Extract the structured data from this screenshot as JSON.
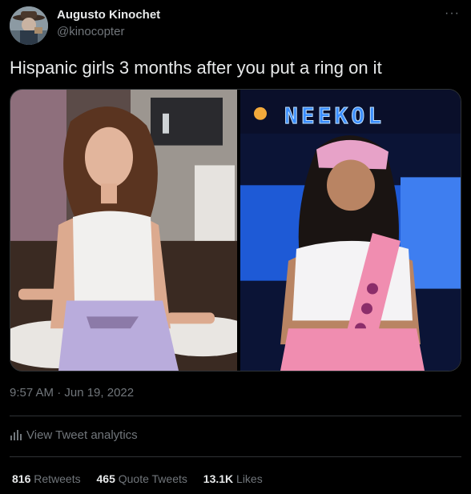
{
  "author": {
    "display_name": "Augusto Kinochet",
    "handle": "@kinocopter"
  },
  "menu_icon": "more-horizontal-icon",
  "tweet": {
    "text": "Hispanic girls 3 months after you put a ring on it"
  },
  "media": {
    "right_sign_text": "NEEKOL"
  },
  "timestamp": "9:57 AM · Jun 19, 2022",
  "analytics": {
    "icon": "bar-chart-icon",
    "label": "View Tweet analytics"
  },
  "stats": {
    "retweets": {
      "count": "816",
      "label": "Retweets"
    },
    "quote_tweets": {
      "count": "465",
      "label": "Quote Tweets"
    },
    "likes": {
      "count": "13.1K",
      "label": "Likes"
    }
  },
  "colors": {
    "background": "#000000",
    "primary_text": "#e7e9ea",
    "secondary_text": "#71767b",
    "divider": "#2f3336"
  }
}
